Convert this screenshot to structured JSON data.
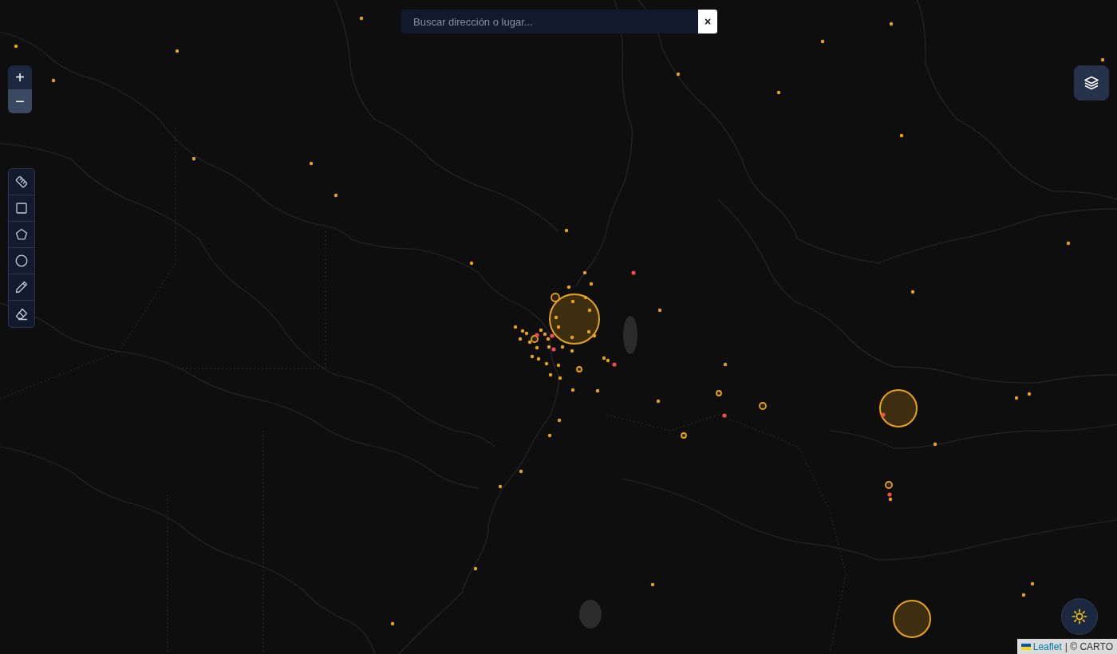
{
  "search": {
    "placeholder": "Buscar dirección o lugar...",
    "clear_label": "×"
  },
  "zoom": {
    "in_label": "+",
    "out_label": "−"
  },
  "draw_tools": [
    {
      "kind": "ruler"
    },
    {
      "kind": "rectangle"
    },
    {
      "kind": "polygon"
    },
    {
      "kind": "circle"
    },
    {
      "kind": "pencil"
    },
    {
      "kind": "eraser"
    }
  ],
  "theme_toggle": {
    "dark": true
  },
  "attribution": {
    "link": "Leaflet",
    "text": "| © CARTO"
  }
}
